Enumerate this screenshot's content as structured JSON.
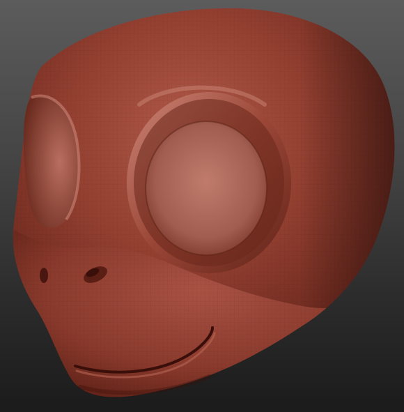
{
  "viewport": {
    "background_top": "#5c5c5c",
    "background_bottom": "#1b1b1b"
  },
  "model": {
    "material_base": "#8a3a2c",
    "material_highlight": "#c9786a",
    "material_shadow": "#4a1710",
    "wireframe_visible": true,
    "features": [
      "head",
      "eye-socket-right",
      "eye-socket-left",
      "nostril-right",
      "nostril-left",
      "mouth"
    ]
  }
}
